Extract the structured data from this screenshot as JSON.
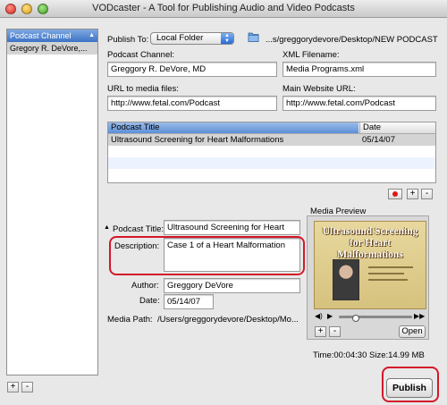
{
  "window": {
    "title": "VODcaster -  A Tool for Publishing Audio and Video Podcasts"
  },
  "sidebar": {
    "header": "Podcast Channel",
    "items": [
      {
        "label": "Gregory R. DeVore,..."
      }
    ],
    "add_label": "+",
    "remove_label": "-"
  },
  "publish_to": {
    "label": "Publish To:",
    "selected": "Local Folder",
    "path": "...s/greggorydevore/Desktop/NEW PODCAST"
  },
  "podcast_channel": {
    "label": "Podcast Channel:",
    "value": "Greggory R. DeVore, MD"
  },
  "xml_filename": {
    "label": "XML Filename:",
    "value": "Media Programs.xml"
  },
  "url_media": {
    "label": "URL to media files:",
    "value": "http://www.fetal.com/Podcast"
  },
  "main_site_url": {
    "label": "Main Website URL:",
    "value": "http://www.fetal.com/Podcast"
  },
  "episodes_table": {
    "columns": [
      "Podcast Title",
      "Date"
    ],
    "rows": [
      {
        "title": "Ultrasound Screening for Heart Malformations",
        "date": "05/14/07"
      }
    ]
  },
  "table_buttons": {
    "add_label": "+",
    "remove_label": "-"
  },
  "episode": {
    "title_label": "Podcast Title:",
    "title_value": "Ultrasound Screening for Heart",
    "description_label": "Description:",
    "description_value": "Case 1 of a Heart Malformation",
    "author_label": "Author:",
    "author_value": "Greggory DeVore",
    "date_label": "Date:",
    "date_value": "05/14/07",
    "media_path_label": "Media Path:",
    "media_path_value": "/Users/greggorydevore/Desktop/Mo..."
  },
  "media_preview": {
    "label": "Media Preview",
    "slide_title": "Ultrasound Screening for Heart Malformations",
    "open_label": "Open",
    "zoom_in_label": "+",
    "zoom_out_label": "-",
    "info": "Time:00:04:30 Size:14.99 MB",
    "playback_position": 0.2
  },
  "publish_button": {
    "label": "Publish"
  },
  "colors": {
    "annotation_red": "#d4182a",
    "selection_blue": "#3d73c6"
  }
}
